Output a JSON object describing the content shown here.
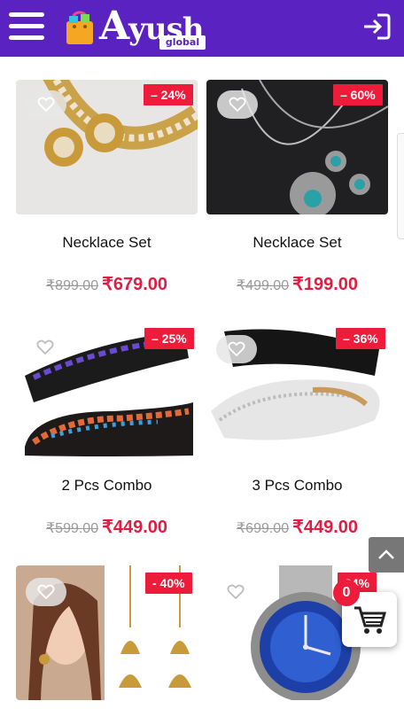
{
  "app": {
    "logo_main": "yush",
    "logo_initial": "A",
    "logo_sub": "global"
  },
  "colors": {
    "header": "#5b22c2",
    "discount_badge": "#ee1c3b",
    "price": "#e21d43"
  },
  "icons": {
    "menu": "hamburger-menu-icon",
    "login": "login-icon",
    "wishlist": "heart-outline-icon",
    "scroll_top": "chevron-up-icon",
    "cart": "shopping-cart-icon"
  },
  "products": [
    {
      "name": "Necklace Set",
      "discount": "– 24%",
      "old_price": "₹899.00",
      "price": "₹679.00"
    },
    {
      "name": "Necklace Set",
      "discount": "– 60%",
      "old_price": "₹499.00",
      "price": "₹199.00"
    },
    {
      "name": "2 Pcs Combo",
      "discount": "– 25%",
      "old_price": "₹599.00",
      "price": "₹449.00"
    },
    {
      "name": "3 Pcs Combo",
      "discount": "– 36%",
      "old_price": "₹699.00",
      "price": "₹449.00"
    },
    {
      "name": "",
      "discount": "- 40%",
      "old_price": "",
      "price": ""
    },
    {
      "name": "",
      "discount": "24%",
      "old_price": "",
      "price": ""
    }
  ],
  "cart": {
    "count": "0"
  }
}
